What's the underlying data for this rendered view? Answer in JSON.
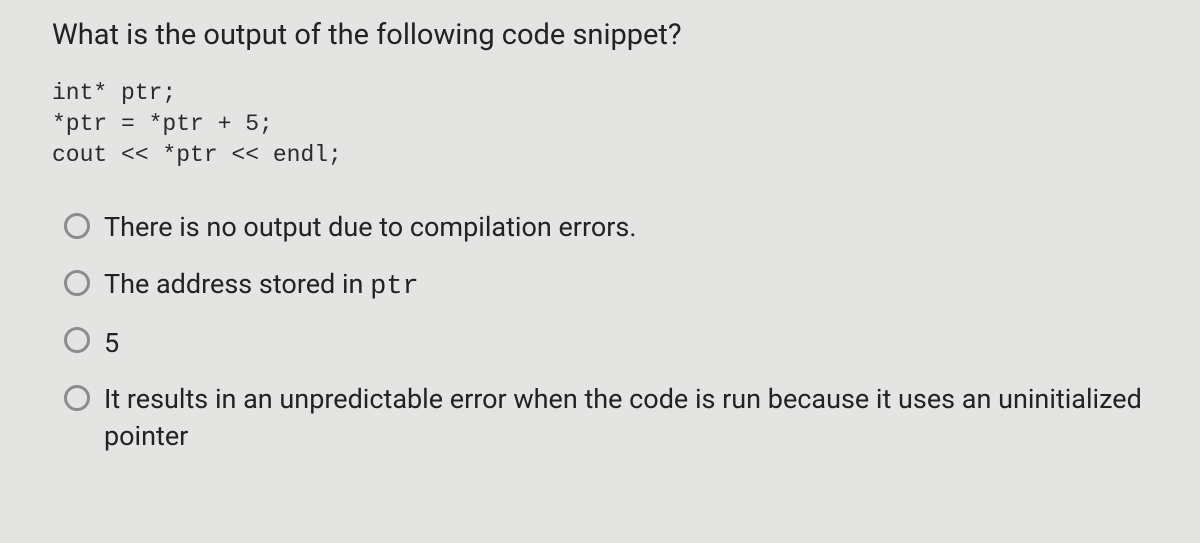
{
  "question": "What is the output of the following code snippet?",
  "code": {
    "line1": "int* ptr;",
    "line2": "*ptr = *ptr + 5;",
    "line3": "cout << *ptr << endl;"
  },
  "options": {
    "a": "There is no output due to compilation errors.",
    "b_prefix": "The address stored in ",
    "b_mono": "ptr",
    "c": "5",
    "d": "It results in an unpredictable error when the code is run because it uses an uninitialized pointer"
  }
}
